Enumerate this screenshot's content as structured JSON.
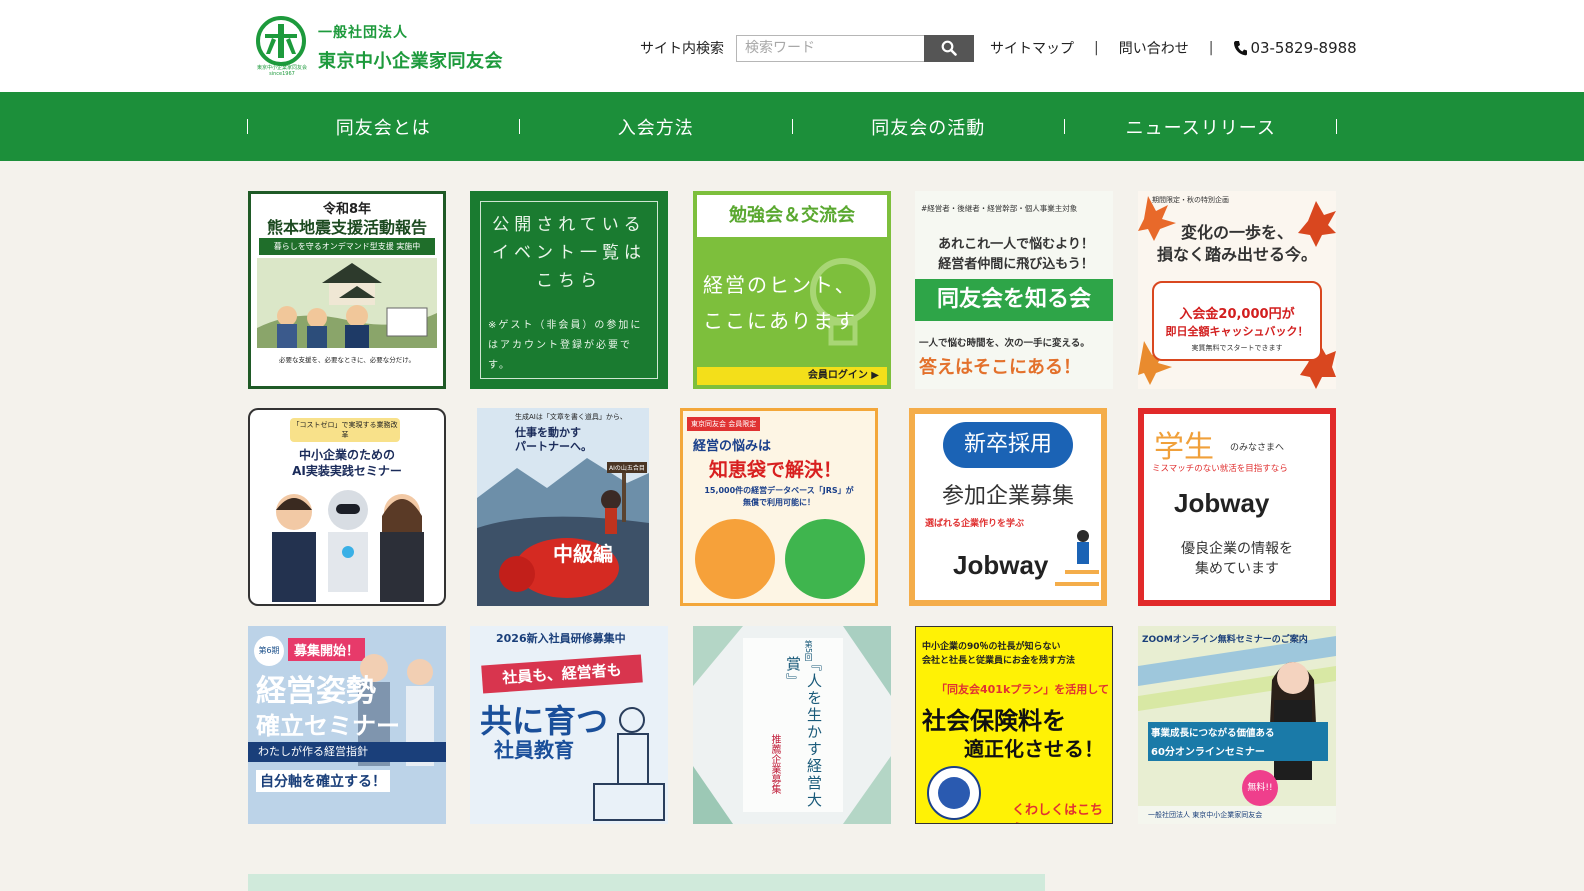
{
  "header": {
    "org_type": "一般社団法人",
    "org_name": "東京中小企業家同友会",
    "logo_small": "東京中小企業家同友会",
    "logo_since": "since1967",
    "search_label": "サイト内検索",
    "search_placeholder": "検索ワード",
    "sitemap": "サイトマップ",
    "separator": "|",
    "contact": "問い合わせ",
    "tel": "03-5829-8988"
  },
  "nav": {
    "items": [
      {
        "label": "同友会とは"
      },
      {
        "label": "入会方法"
      },
      {
        "label": "同友会の活動"
      },
      {
        "label": "ニュースリリース"
      }
    ]
  },
  "banners": {
    "b1": {
      "top": "令和8年",
      "title": "熊本地震支援活動報告",
      "sub": "暮らしを守るオンデマンド型支援 実施中",
      "foot": "必要な支援を、必要なときに、必要な分だけ。"
    },
    "b2": {
      "main": "公開されているイベント一覧はこちら",
      "note": "※ゲスト（非会員）の参加にはアカウント登録が必要です。"
    },
    "b3": {
      "title": "勉強会＆交流会",
      "main1": "経営のヒント、",
      "main2": "ここにあります",
      "foot": "会員ログイン ▶"
    },
    "b4": {
      "tag": "#経営者・後継者・経営幹部・個人事業主対象",
      "line1": "あれこれ一人で悩むより！",
      "line2": "経営者仲間に飛び込もう！",
      "band": "同友会を知る会",
      "line3": "一人で悩む時間を、次の一手に変える。",
      "line4": "答えはそこにある！"
    },
    "b5": {
      "tag": "期間限定・秋の特別企画",
      "line1": "変化の一歩を、",
      "line2": "損なく踏み出せる今。",
      "line3": "入会金20,000円が",
      "line4": "即日全額キャッシュバック！",
      "foot": "実質無料でスタートできます"
    },
    "b6": {
      "badge": "「コストゼロ」で実現する業務改革",
      "title1": "中小企業のための",
      "title2": "AI実装実践セミナー"
    },
    "b7": {
      "top": "生成AIは「文章を書く道具」から、",
      "line1": "仕事を動かす",
      "line2": "パートナーへ。",
      "sign": "AIの山五合目",
      "main": "中級編"
    },
    "b8": {
      "tag": "東京同友会 会員限定",
      "line1": "経営の悩みは",
      "line2": "知恵袋で解決！",
      "line3": "15,000件の経営データベース「JRS」が",
      "line4": "無償で利用可能に！"
    },
    "b9": {
      "line1": "新卒採用",
      "line2": "参加企業募集",
      "line3": "選ばれる企業作りを学ぶ",
      "logo": "Jobway"
    },
    "b10": {
      "line1": "学生",
      "line1b": "のみなさまへ",
      "line2": "ミスマッチのない就活を目指すなら",
      "logo": "Jobway",
      "line3": "優良企業の情報を",
      "line4": "集めています"
    },
    "b11": {
      "badge": "第6期",
      "tag": "募集開始！",
      "title1": "経営姿勢",
      "title2": "確立セミナー",
      "sub": "わたしが作る経営指針",
      "foot": "自分軸を確立する！"
    },
    "b12": {
      "top": "2026新入社員研修募集中",
      "line1": "社員も、経営者も",
      "main": "共に育つ",
      "main2": "社員教育"
    },
    "b13": {
      "vertical": "『人を生かす経営大賞』",
      "sub": "推薦企業募集",
      "num": "第5回"
    },
    "b14": {
      "line1": "中小企業の90％の社長が知らない",
      "line2": "会社と社長と従業員にお金を残す方法",
      "line3": "「同友会401kプラン」を活用して",
      "main1": "社会保険料を",
      "main2": "適正化させる！",
      "foot": "くわしくはこちら"
    },
    "b15": {
      "top": "ZOOMオンライン無料セミナーのご案内",
      "line1": "事業成長につながる価値ある",
      "line2": "60分オンラインセミナー",
      "badge": "無料!!",
      "foot": "一般社団法人 東京中小企業家同友会"
    }
  },
  "colors": {
    "brand_green": "#1c8f3a",
    "logo_green": "#1d9a3c",
    "page_bg": "#f4f2ec"
  }
}
